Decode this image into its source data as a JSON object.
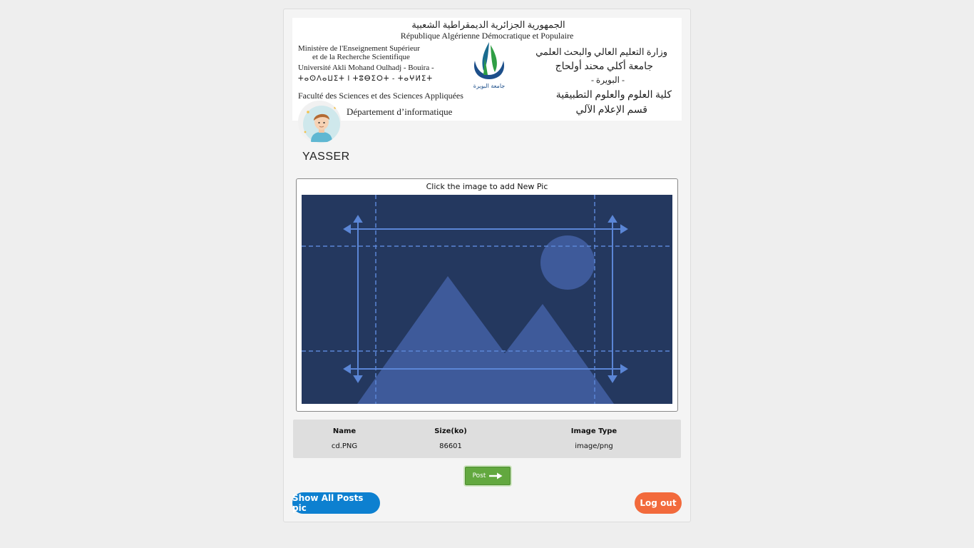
{
  "banner": {
    "arabic_title": "الجمهورية الجزائرية الديمقراطية الشعبية",
    "french_title": "République Algérienne Démocratique et Populaire",
    "left_lines": [
      "Ministère de l'Enseignement Supérieur",
      "et de la Recherche Scientifique",
      "Université Akli Mohand Oulhadj - Bouira -",
      "ⵜⴰⵙⴷⴰⵡⵉⵜ ⵏ ⵜⵓⴱⵉⵔⵜ - ⵜⴰⵖⵍⵉⵜ",
      "Faculté des Sciences et des Sciences Appliquées",
      "Département d’informatique"
    ],
    "right_lines": [
      "وزارة التعليم العالي والبحث العلمي",
      "جامعة أكلي محند أولحاج",
      "- البويرة -",
      "كلية العلوم والعلوم التطبيقية",
      "قسم الإعلام الآلي"
    ],
    "logo_caption": "جامعة البويرة"
  },
  "profile": {
    "username": "YASSER"
  },
  "upload": {
    "caption": "Click the image to add New Pic"
  },
  "file_info": {
    "headers": [
      "Name",
      "Size(ko)",
      "Image Type"
    ],
    "values": [
      "cd.PNG",
      "86601",
      "image/png"
    ]
  },
  "actions": {
    "post_label": "Post",
    "show_all_label": "Show All Posts pic",
    "logout_label": "Log out"
  },
  "colors": {
    "image_bg": "#24385f",
    "image_shape": "#3e5a9a",
    "image_lines": "#5b86d6",
    "post_btn": "#62a83f",
    "show_btn": "#0d80d0",
    "logout_btn": "#f26a3c"
  },
  "icons": {
    "post_arrow": "arrow-right-icon",
    "placeholder": "image-placeholder-icon",
    "avatar": "user-avatar-icon"
  }
}
